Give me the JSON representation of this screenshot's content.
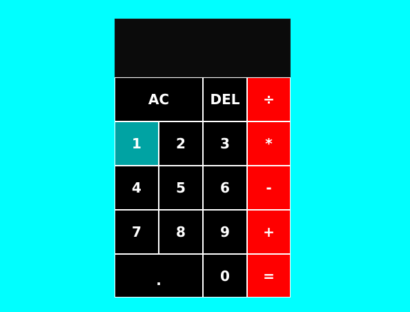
{
  "calculator": {
    "display": "",
    "keys": {
      "ac": "AC",
      "del": "DEL",
      "divide": "÷",
      "one": "1",
      "two": "2",
      "three": "3",
      "multiply": "*",
      "four": "4",
      "five": "5",
      "six": "6",
      "subtract": "-",
      "seven": "7",
      "eight": "8",
      "nine": "9",
      "add": "+",
      "decimal": ".",
      "zero": "0",
      "equals": "="
    }
  },
  "colors": {
    "page_background": "#00ffff",
    "key_background": "#000000",
    "operator_background": "#ff0000",
    "active_key_background": "#00a3a3",
    "key_border": "#ffffff",
    "key_text": "#ffffff"
  }
}
